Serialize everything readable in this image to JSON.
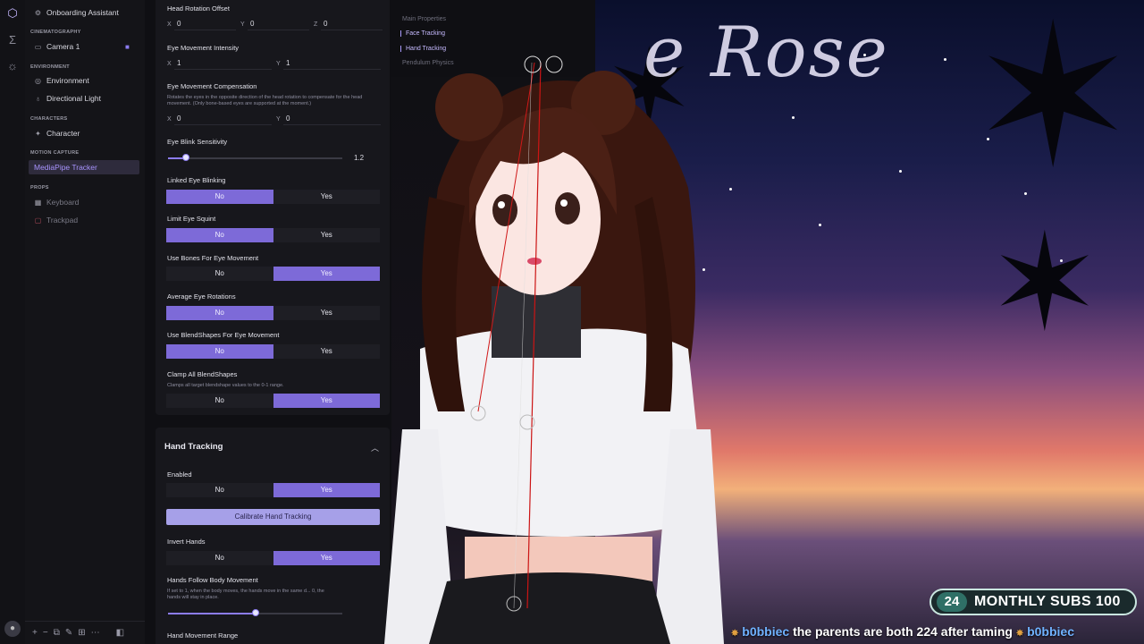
{
  "tree": {
    "onboarding": "Onboarding Assistant",
    "cat_cinematography": "CINEMATOGRAPHY",
    "camera": "Camera 1",
    "cat_environment": "ENVIRONMENT",
    "environment": "Environment",
    "directional_light": "Directional Light",
    "cat_characters": "CHARACTERS",
    "character": "Character",
    "cat_motion_capture": "MOTION CAPTURE",
    "mediapipe": "MediaPipe Tracker",
    "cat_props": "PROPS",
    "keyboard": "Keyboard",
    "trackpad": "Trackpad"
  },
  "face": {
    "head_rotation_offset": "Head Rotation Offset",
    "hro_x": "0",
    "hro_y": "0",
    "hro_z": "0",
    "eye_movement_intensity": "Eye Movement Intensity",
    "emi_x": "1",
    "emi_y": "1",
    "eye_movement_compensation": "Eye Movement Compensation",
    "emc_desc": "Rotates the eyes in the opposite direction of the head rotation to compensate for the head movement. (Only bone-based eyes are supported at the moment.)",
    "emc_x": "0",
    "emc_y": "0",
    "eye_blink_sensitivity": "Eye Blink Sensitivity",
    "eye_blink_value": "1.2",
    "eye_blink_fraction": 0.1,
    "linked_eye_blinking": "Linked Eye Blinking",
    "limit_eye_squint": "Limit Eye Squint",
    "use_bones": "Use Bones For Eye Movement",
    "average_eye_rotations": "Average Eye Rotations",
    "use_blendshapes": "Use BlendShapes For Eye Movement",
    "clamp_blendshapes": "Clamp All BlendShapes",
    "clamp_desc": "Clamps all target blendshape values to the 0-1 range.",
    "no": "No",
    "yes": "Yes"
  },
  "hand": {
    "section_title": "Hand Tracking",
    "enabled": "Enabled",
    "calibrate": "Calibrate Hand Tracking",
    "invert_hands": "Invert Hands",
    "follow_body": "Hands Follow Body Movement",
    "follow_desc": "If set to 1, when the body moves, the hands move in the same d... 0, the hands will stay in place.",
    "follow_fraction": 0.5,
    "movement_range": "Hand Movement Range"
  },
  "nav": {
    "main_properties": "Main Properties",
    "face_tracking": "Face Tracking",
    "hand_tracking": "Hand Tracking",
    "pendulum_physics": "Pendulum Physics"
  },
  "overlay": {
    "title_text": "e Rose",
    "subs_count": "24",
    "subs_label": "MONTHLY SUBS 100",
    "ticker_user1": "b0bbiec",
    "ticker_msg": " the parents are both 224 after taming ",
    "ticker_user2": "b0bbiec"
  },
  "colors": {
    "accent": "#7d6ad8",
    "accent_light": "#a994ff",
    "panel": "#17171c"
  }
}
